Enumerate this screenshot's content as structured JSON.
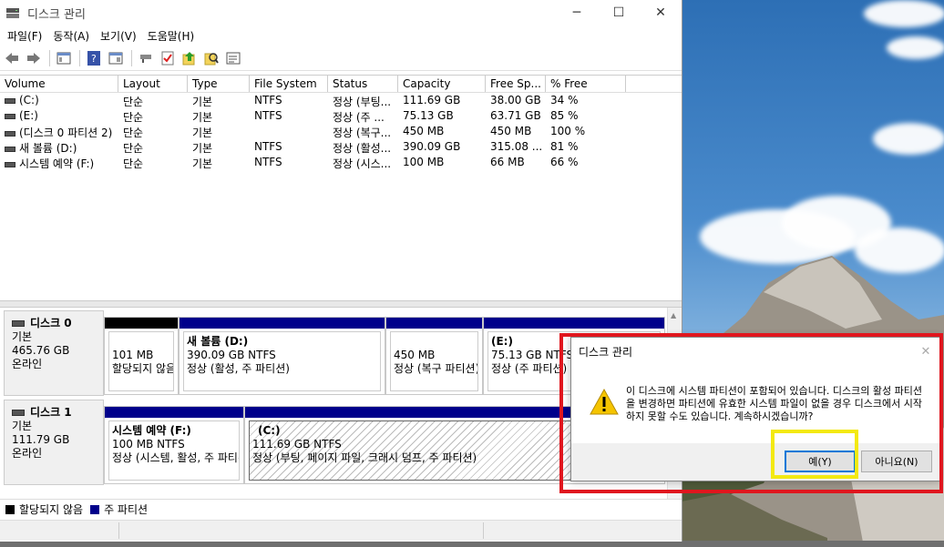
{
  "window": {
    "title": "디스크 관리",
    "controls": {
      "minimize": "─",
      "maximize": "☐",
      "close": "✕"
    }
  },
  "menu": [
    "파일(F)",
    "동작(A)",
    "보기(V)",
    "도움말(H)"
  ],
  "toolbar": {
    "icons": [
      "back-arrow-icon",
      "forward-arrow-icon",
      "console-tree-icon",
      "help-icon",
      "properties-icon",
      "connect-icon",
      "check-icon",
      "export-icon",
      "search-icon",
      "settings-list-icon"
    ]
  },
  "volume_list": {
    "columns": [
      "Volume",
      "Layout",
      "Type",
      "File System",
      "Status",
      "Capacity",
      "Free Sp...",
      "% Free"
    ],
    "rows": [
      {
        "volume": "(C:)",
        "layout": "단순",
        "type": "기본",
        "fs": "NTFS",
        "status": "정상 (부팅...",
        "capacity": "111.69 GB",
        "free": "38.00 GB",
        "pct": "34 %"
      },
      {
        "volume": "(E:)",
        "layout": "단순",
        "type": "기본",
        "fs": "NTFS",
        "status": "정상 (주 ...",
        "capacity": "75.13 GB",
        "free": "63.71 GB",
        "pct": "85 %"
      },
      {
        "volume": "(디스크 0 파티션 2)",
        "layout": "단순",
        "type": "기본",
        "fs": "",
        "status": "정상 (복구...",
        "capacity": "450 MB",
        "free": "450 MB",
        "pct": "100 %"
      },
      {
        "volume": "새 볼륨 (D:)",
        "layout": "단순",
        "type": "기본",
        "fs": "NTFS",
        "status": "정상 (활성...",
        "capacity": "390.09 GB",
        "free": "315.08 ...",
        "pct": "81 %"
      },
      {
        "volume": "시스템 예약 (F:)",
        "layout": "단순",
        "type": "기본",
        "fs": "NTFS",
        "status": "정상 (시스...",
        "capacity": "100 MB",
        "free": "66 MB",
        "pct": "66 %"
      }
    ]
  },
  "disks": [
    {
      "name": "디스크 0",
      "type": "기본",
      "size": "465.76 GB",
      "state": "온라인",
      "partitions": [
        {
          "name": "",
          "size": "101 MB",
          "status": "할당되지 않음",
          "kind": "unallocated"
        },
        {
          "name": "새 볼륨  (D:)",
          "size": "390.09 GB NTFS",
          "status": "정상 (활성, 주 파티션)",
          "kind": "primary"
        },
        {
          "name": "",
          "size": "450 MB",
          "status": "정상 (복구 파티션)",
          "kind": "primary"
        },
        {
          "name": "(E:)",
          "size": "75.13 GB NTFS",
          "status": "정상 (주 파티션)",
          "kind": "primary"
        }
      ]
    },
    {
      "name": "디스크 1",
      "type": "기본",
      "size": "111.79 GB",
      "state": "온라인",
      "partitions": [
        {
          "name": "시스템 예약  (F:)",
          "size": "100 MB NTFS",
          "status": "정상 (시스템, 활성, 주 파티션)",
          "kind": "primary"
        },
        {
          "name": "(C:)",
          "size": "111.69 GB NTFS",
          "status": "정상 (부팅, 페이지 파일, 크래시 덤프, 주 파티션)",
          "kind": "primary-selected"
        }
      ]
    }
  ],
  "legend": [
    {
      "label": "할당되지 않음",
      "color": "#000000"
    },
    {
      "label": "주 파티션",
      "color": "#00008b"
    }
  ],
  "dialog": {
    "title": "디스크 관리",
    "message": "이 디스크에 시스템 파티션이 포함되어 있습니다. 디스크의 활성 파티션을 변경하면 파티션에 유효한 시스템 파일이 없을 경우 디스크에서 시작하지 못할 수도 있습니다. 계속하시겠습니까?",
    "yes_label": "예(Y)",
    "no_label": "아니요(N)",
    "icon": "warning-icon",
    "close": "✕"
  },
  "colors": {
    "primary_partition": "#00008b",
    "unallocated": "#000000",
    "highlight_red": "#e0161e",
    "highlight_yellow": "#f3e912",
    "dialog_focus": "#0078d7"
  }
}
